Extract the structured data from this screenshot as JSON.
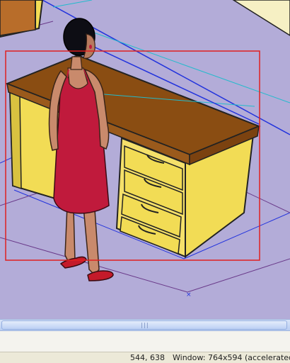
{
  "viewport": {
    "background": "#b3acd8",
    "selection_color": "#e02020",
    "guide_color": "#2233dd"
  },
  "scroll": {
    "grip_glyph": "|||"
  },
  "status": {
    "coords": "544, 638",
    "window": "Window: 764x594 (accelerated)"
  }
}
